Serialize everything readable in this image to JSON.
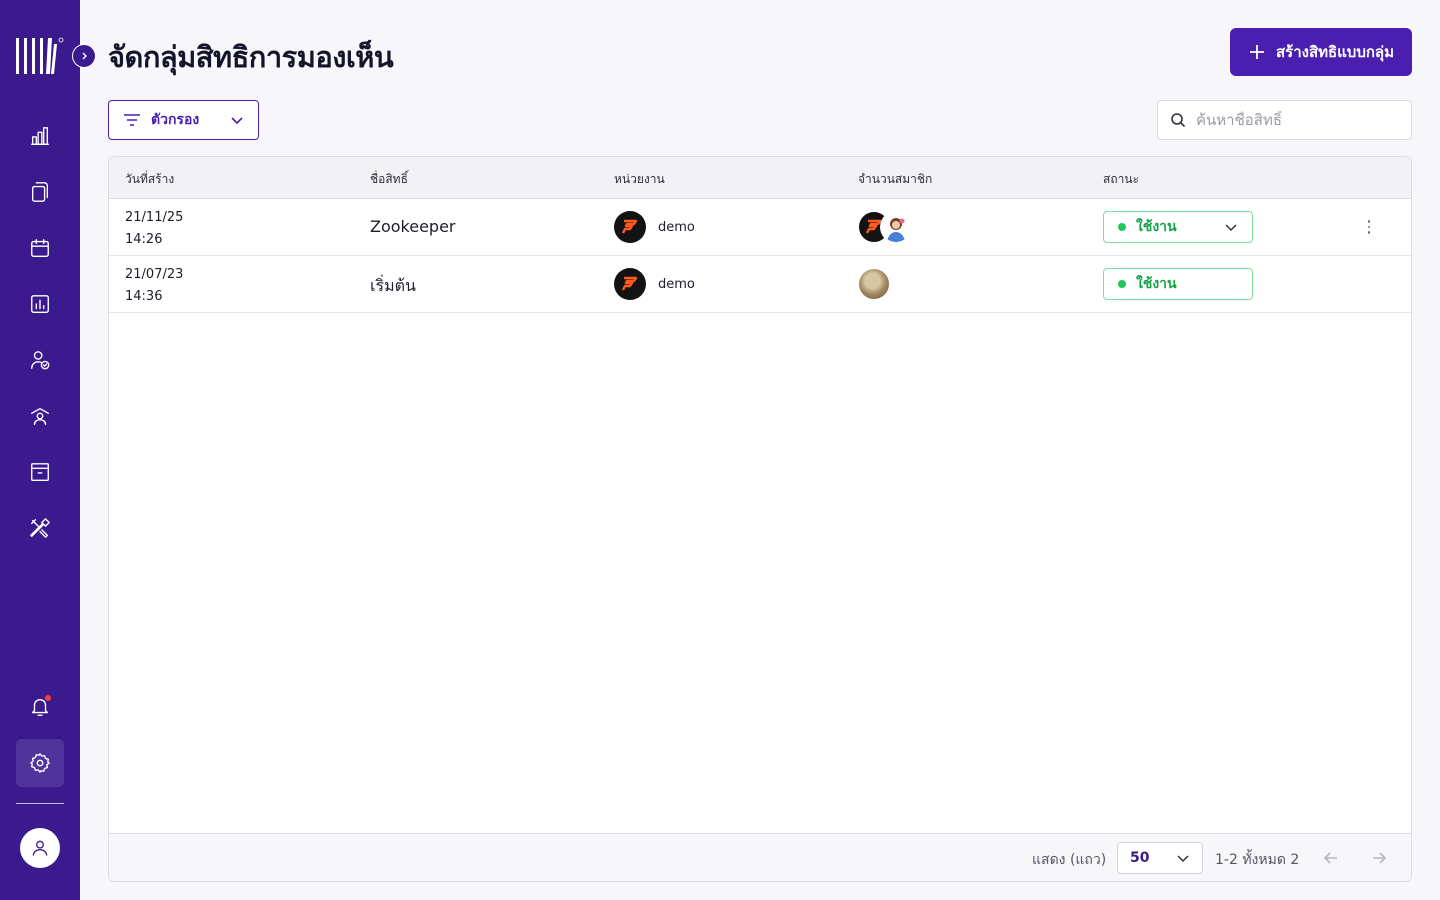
{
  "app": {
    "page_title": "จัดกลุ่มสิทธิการมองเห็น",
    "create_button": "สร้างสิทธิแบบกลุ่ม"
  },
  "sidebar": {
    "items": [
      {
        "icon": "bar-chart-icon"
      },
      {
        "icon": "documents-icon"
      },
      {
        "icon": "calendar-icon"
      },
      {
        "icon": "report-chart-icon"
      },
      {
        "icon": "user-check-icon"
      },
      {
        "icon": "user-broadcast-icon"
      },
      {
        "icon": "archive-box-icon"
      },
      {
        "icon": "tools-icon"
      }
    ],
    "bottom": [
      {
        "icon": "bell-icon",
        "has_notification": true
      },
      {
        "icon": "gear-icon",
        "active": true
      }
    ],
    "profile_icon": "user-icon"
  },
  "toolbar": {
    "filter_label": "ตัวกรอง",
    "search_placeholder": "ค้นหาชื่อสิทธิ์"
  },
  "table": {
    "columns": [
      "วันที่สร้าง",
      "ชื่อสิทธิ์",
      "หน่วยงาน",
      "จำนวนสมาชิก",
      "สถานะ"
    ],
    "rows": [
      {
        "date": "21/11/25",
        "time": "14:26",
        "name": "Zookeeper",
        "unit": "demo",
        "members": [
          "brand-logo",
          "girl-avatar"
        ],
        "status": "ใช้งาน",
        "has_dropdown": true
      },
      {
        "date": "21/07/23",
        "time": "14:36",
        "name": "เริ่มต้น",
        "unit": "demo",
        "members": [
          "photo-avatar"
        ],
        "status": "ใช้งาน",
        "has_dropdown": false
      }
    ]
  },
  "pagination": {
    "rows_label": "แสดง (แถว)",
    "page_size": "50",
    "range": "1-2 ทั้งหมด 2"
  },
  "colors": {
    "sidebar": "#3a1a8c",
    "primary": "#4a1fb0",
    "status_green": "#17a34a",
    "notification": "#ff3b3b"
  }
}
